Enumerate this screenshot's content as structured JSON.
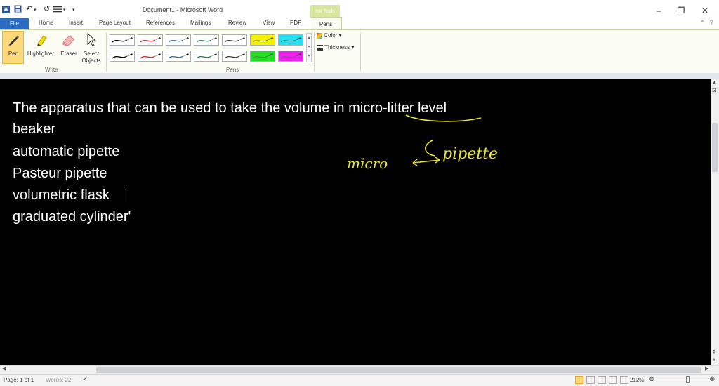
{
  "window": {
    "title": "Document1 - Microsoft Word",
    "context_tab": "Ink Tools",
    "controls": {
      "minimize": "–",
      "restore": "❐",
      "close": "✕"
    }
  },
  "quick_access": {
    "word_icon": "W",
    "save": "💾",
    "undo": "↶",
    "redo": "↺",
    "customize": "▾"
  },
  "tabs": {
    "file": "File",
    "items": [
      "Home",
      "Insert",
      "Page Layout",
      "References",
      "Mailings",
      "Review",
      "View",
      "PDF"
    ],
    "pens": "Pens"
  },
  "ribbon": {
    "write_group": {
      "label": "Write",
      "pen": "Pen",
      "highlighter": "Highlighter",
      "eraser": "Eraser",
      "select_objects_1": "Select",
      "select_objects_2": "Objects"
    },
    "pens_group": {
      "label": "Pens",
      "swatches": [
        {
          "color": "#000000",
          "kind": "pen"
        },
        {
          "color": "#d42a2a",
          "kind": "pen"
        },
        {
          "color": "#3a6b8f",
          "kind": "pen"
        },
        {
          "color": "#2e7d5a",
          "kind": "pen"
        },
        {
          "color": "#444444",
          "kind": "pen"
        },
        {
          "color": "#f2f200",
          "kind": "highlighter"
        },
        {
          "color": "#22e0f0",
          "kind": "highlighter"
        },
        {
          "color": "#000000",
          "kind": "pen"
        },
        {
          "color": "#d42a2a",
          "kind": "pen"
        },
        {
          "color": "#3a6b8f",
          "kind": "pen"
        },
        {
          "color": "#2e7d5a",
          "kind": "pen"
        },
        {
          "color": "#444444",
          "kind": "pen"
        },
        {
          "color": "#22e022",
          "kind": "highlighter"
        },
        {
          "color": "#f020f0",
          "kind": "highlighter"
        }
      ]
    },
    "color_label": "Color",
    "thickness_label": "Thickness"
  },
  "document": {
    "lines": [
      "The apparatus that can be used to take the volume in micro-litter level",
      "beaker",
      "automatic pipette",
      "Pasteur pipette",
      "volumetric flask",
      "graduated cylinder'"
    ],
    "ink_annotation": {
      "word1": "micro",
      "word2": "pipette",
      "color": "#e8e230"
    }
  },
  "status": {
    "page": "Page: 1 of 1",
    "words": "Words: 22",
    "zoom": "212%"
  }
}
